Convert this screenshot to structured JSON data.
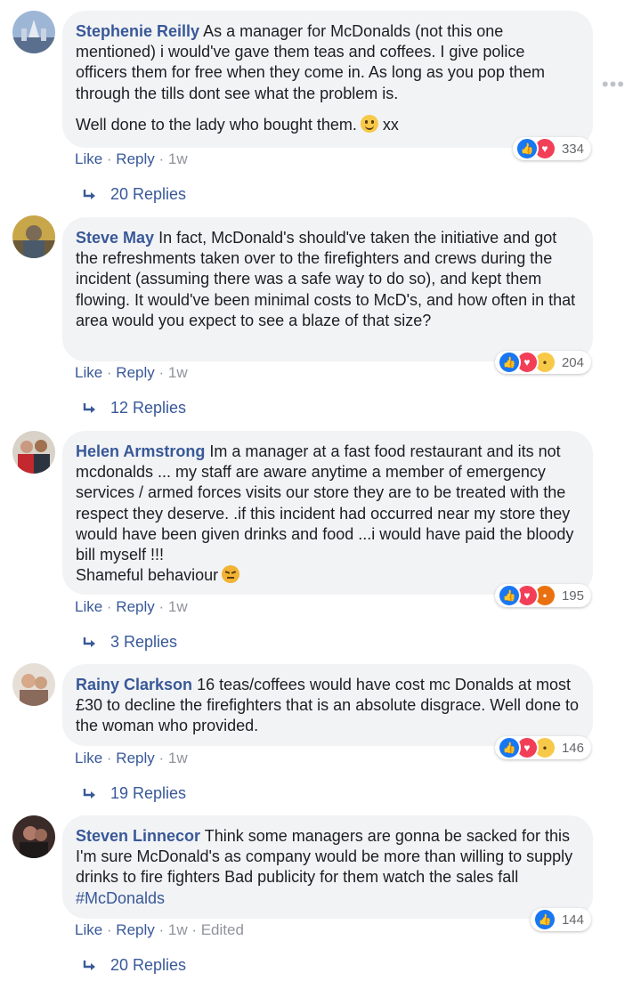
{
  "more_label": "•••",
  "comments": [
    {
      "author": "Stephenie Reilly",
      "paragraphs": [
        "As a manager for McDonalds (not this one mentioned) i would've gave them teas and coffees. I give police officers them for free when they come in. As long as you pop them through the tills dont see what the problem is.",
        "Well done to the lady who bought them."
      ],
      "trailing_text": "xx",
      "emoji": "smile-emoji",
      "reaction_types": [
        "like",
        "love"
      ],
      "reaction_count": "334",
      "actions": {
        "like": "Like",
        "reply": "Reply",
        "time": "1w"
      },
      "replies": "20 Replies"
    },
    {
      "author": "Steve May",
      "paragraphs": [
        "In fact, McDonald's should've taken the initiative and got the refreshments taken over to the firefighters and crews during the incident (assuming there was a safe way to do so), and kept them flowing. It would've been minimal costs to McD's, and how often in that area would you expect to see a blaze of that size?"
      ],
      "reaction_types": [
        "like",
        "love",
        "haha"
      ],
      "reaction_count": "204",
      "actions": {
        "like": "Like",
        "reply": "Reply",
        "time": "1w"
      },
      "replies": "12 Replies"
    },
    {
      "author": "Helen Armstrong",
      "paragraphs": [
        "Im a manager at a fast food restaurant and its not mcdonalds ... my staff are aware anytime a member of emergency services / armed forces visits our store they are to be treated with the respect they deserve. .if this incident had occurred near my store they would have been given drinks and food ...i would have paid the bloody bill myself !!!\nShameful behaviour"
      ],
      "emoji": "angry-emoji",
      "reaction_types": [
        "like",
        "love",
        "angry"
      ],
      "reaction_count": "195",
      "actions": {
        "like": "Like",
        "reply": "Reply",
        "time": "1w"
      },
      "replies": "3 Replies"
    },
    {
      "author": "Rainy Clarkson",
      "paragraphs": [
        "16 teas/coffees would have cost mc Donalds at most £30 to decline the firefighters that is an absolute disgrace. Well done to the woman who provided."
      ],
      "reaction_types": [
        "like",
        "love",
        "sad"
      ],
      "reaction_count": "146",
      "actions": {
        "like": "Like",
        "reply": "Reply",
        "time": "1w"
      },
      "replies": "19 Replies"
    },
    {
      "author": "Steven Linnecor",
      "paragraphs": [
        "Think some managers are gonna be sacked for this I'm sure McDonald's as company would be more than willing to supply drinks to fire fighters Bad publicity for them watch the sales fall"
      ],
      "hashtag": "#McDonalds",
      "reaction_types": [
        "like"
      ],
      "reaction_count": "144",
      "actions": {
        "like": "Like",
        "reply": "Reply",
        "time": "1w",
        "edited": "Edited"
      },
      "replies": "20 Replies"
    }
  ],
  "colors": {
    "link": "#385898",
    "bubble": "#f2f3f5",
    "meta": "#90949c"
  }
}
